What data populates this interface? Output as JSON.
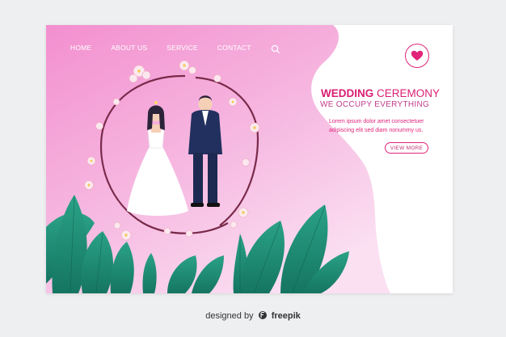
{
  "nav": {
    "items": [
      {
        "label": "HOME"
      },
      {
        "label": "ABOUT US"
      },
      {
        "label": "SERVICE"
      },
      {
        "label": "CONTACT"
      }
    ]
  },
  "hero": {
    "title_bold": "WEDDING",
    "title_light": " CEREMONY",
    "subtitle": "WE OCCUPY EVERYTHING",
    "body_lines": [
      "Lorem ipsum dolor amet consectetuer",
      "adipiscing elit sed diam nonummy us."
    ],
    "cta_label": "VIEW MORE"
  },
  "credit": {
    "prefix": "designed by",
    "brand": "freepik"
  },
  "colors": {
    "accent": "#e0247a",
    "pink_bg": "#f4a8d8",
    "leaf": "#1f8a74",
    "page_bg": "#eeeff1"
  },
  "icons": {
    "search": "search-icon",
    "heart": "heart-icon",
    "brand": "freepik-logo-icon"
  }
}
